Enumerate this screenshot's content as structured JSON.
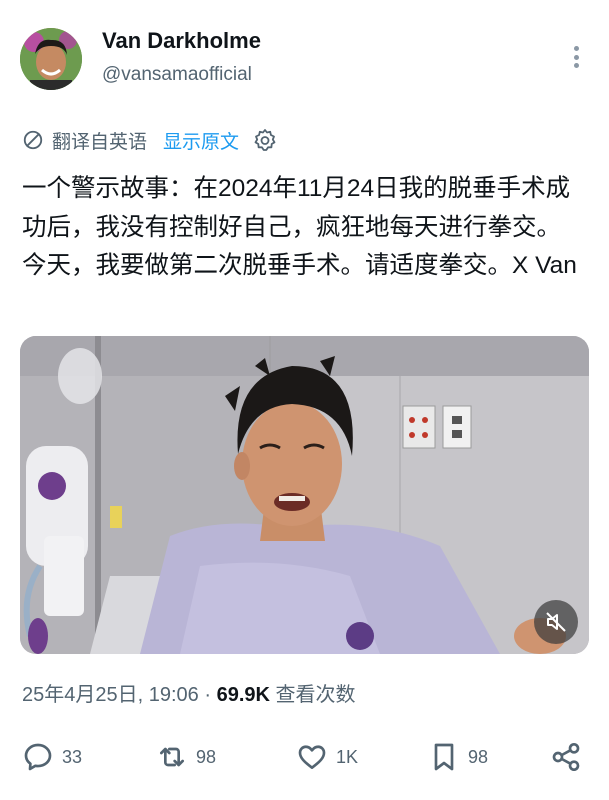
{
  "user": {
    "display_name": "Van Darkholme",
    "handle": "@vansamaofficial"
  },
  "translation": {
    "label": "翻译自英语",
    "show_original": "显示原文"
  },
  "tweet": {
    "text": "一个警示故事：在2024年11月24日我的脱垂手术成功后，我没有控制好自己，疯狂地每天进行拳交。今天，我要做第二次脱垂手术。请适度拳交。X Van"
  },
  "meta": {
    "timestamp": "25年4月25日, 19:06",
    "separator": "·",
    "views_count": "69.9K",
    "views_label": "查看次数"
  },
  "actions": {
    "replies": "33",
    "reposts": "98",
    "likes": "1K",
    "bookmarks": "98"
  },
  "icons": [
    "globe-translate-icon",
    "gear-icon",
    "more-icon",
    "mute-icon",
    "reply-icon",
    "repost-icon",
    "like-icon",
    "bookmark-icon",
    "share-icon"
  ],
  "colors": {
    "link": "#1d9bf0",
    "secondary_text": "#536471",
    "primary_text": "#0f1419"
  }
}
